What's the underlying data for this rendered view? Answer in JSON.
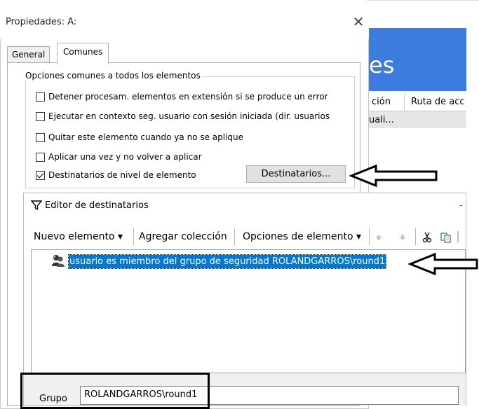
{
  "background_window": {
    "banner_text": "es",
    "column1": "ción",
    "column2": "Ruta de acc",
    "row1": "uali..."
  },
  "properties_dialog": {
    "title": "Propiedades: A:",
    "close_glyph": "✕",
    "tabs": [
      {
        "label": "General",
        "active": false
      },
      {
        "label": "Comunes",
        "active": true
      }
    ],
    "group_label": "Opciones comunes a todos los elementos",
    "options": [
      {
        "label": "Detener procesam. elementos en extensión si se produce un error",
        "checked": false
      },
      {
        "label": "Ejecutar en contexto seg. usuario con sesión iniciada (dir. usuarios",
        "checked": false
      },
      {
        "label": "Quitar este elemento cuando ya no se aplique",
        "checked": false
      },
      {
        "label": "Aplicar una vez y no volver a aplicar",
        "checked": false
      },
      {
        "label": "Destinatarios de nivel de elemento",
        "checked": true
      }
    ],
    "targets_button": "Destinatarios..."
  },
  "target_editor": {
    "title": "Editor de destinatarios",
    "minimize_glyph": "-",
    "toolbar": {
      "new_item": "Nuevo elemento ▾",
      "add_collection": "Agregar colección",
      "item_options": "Opciones de elemento ▾"
    },
    "tree_item": "usuario es miembro del grupo de seguridad ROLANDGARROS\\round1",
    "group_label": "Grupo",
    "group_value": "ROLANDGARROS\\round1"
  },
  "colors": {
    "banner": "#3c7ce0",
    "selection": "#0078d7"
  }
}
